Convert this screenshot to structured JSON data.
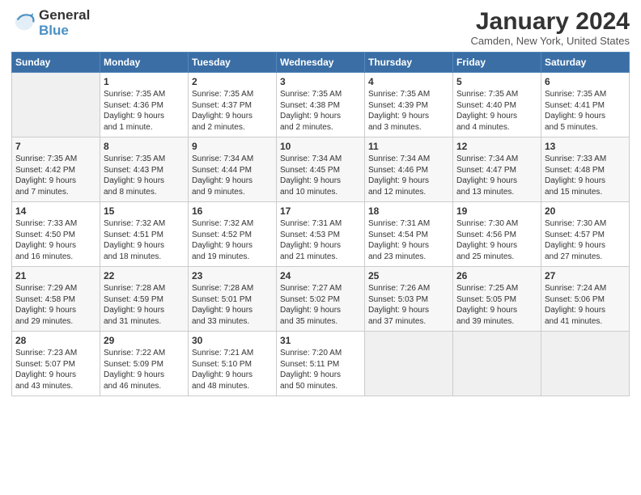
{
  "logo": {
    "text1": "General",
    "text2": "Blue"
  },
  "title": {
    "month_year": "January 2024",
    "location": "Camden, New York, United States"
  },
  "days_of_week": [
    "Sunday",
    "Monday",
    "Tuesday",
    "Wednesday",
    "Thursday",
    "Friday",
    "Saturday"
  ],
  "weeks": [
    [
      {
        "day": "",
        "info": ""
      },
      {
        "day": "1",
        "info": "Sunrise: 7:35 AM\nSunset: 4:36 PM\nDaylight: 9 hours\nand 1 minute."
      },
      {
        "day": "2",
        "info": "Sunrise: 7:35 AM\nSunset: 4:37 PM\nDaylight: 9 hours\nand 2 minutes."
      },
      {
        "day": "3",
        "info": "Sunrise: 7:35 AM\nSunset: 4:38 PM\nDaylight: 9 hours\nand 2 minutes."
      },
      {
        "day": "4",
        "info": "Sunrise: 7:35 AM\nSunset: 4:39 PM\nDaylight: 9 hours\nand 3 minutes."
      },
      {
        "day": "5",
        "info": "Sunrise: 7:35 AM\nSunset: 4:40 PM\nDaylight: 9 hours\nand 4 minutes."
      },
      {
        "day": "6",
        "info": "Sunrise: 7:35 AM\nSunset: 4:41 PM\nDaylight: 9 hours\nand 5 minutes."
      }
    ],
    [
      {
        "day": "7",
        "info": "Sunrise: 7:35 AM\nSunset: 4:42 PM\nDaylight: 9 hours\nand 7 minutes."
      },
      {
        "day": "8",
        "info": "Sunrise: 7:35 AM\nSunset: 4:43 PM\nDaylight: 9 hours\nand 8 minutes."
      },
      {
        "day": "9",
        "info": "Sunrise: 7:34 AM\nSunset: 4:44 PM\nDaylight: 9 hours\nand 9 minutes."
      },
      {
        "day": "10",
        "info": "Sunrise: 7:34 AM\nSunset: 4:45 PM\nDaylight: 9 hours\nand 10 minutes."
      },
      {
        "day": "11",
        "info": "Sunrise: 7:34 AM\nSunset: 4:46 PM\nDaylight: 9 hours\nand 12 minutes."
      },
      {
        "day": "12",
        "info": "Sunrise: 7:34 AM\nSunset: 4:47 PM\nDaylight: 9 hours\nand 13 minutes."
      },
      {
        "day": "13",
        "info": "Sunrise: 7:33 AM\nSunset: 4:48 PM\nDaylight: 9 hours\nand 15 minutes."
      }
    ],
    [
      {
        "day": "14",
        "info": "Sunrise: 7:33 AM\nSunset: 4:50 PM\nDaylight: 9 hours\nand 16 minutes."
      },
      {
        "day": "15",
        "info": "Sunrise: 7:32 AM\nSunset: 4:51 PM\nDaylight: 9 hours\nand 18 minutes."
      },
      {
        "day": "16",
        "info": "Sunrise: 7:32 AM\nSunset: 4:52 PM\nDaylight: 9 hours\nand 19 minutes."
      },
      {
        "day": "17",
        "info": "Sunrise: 7:31 AM\nSunset: 4:53 PM\nDaylight: 9 hours\nand 21 minutes."
      },
      {
        "day": "18",
        "info": "Sunrise: 7:31 AM\nSunset: 4:54 PM\nDaylight: 9 hours\nand 23 minutes."
      },
      {
        "day": "19",
        "info": "Sunrise: 7:30 AM\nSunset: 4:56 PM\nDaylight: 9 hours\nand 25 minutes."
      },
      {
        "day": "20",
        "info": "Sunrise: 7:30 AM\nSunset: 4:57 PM\nDaylight: 9 hours\nand 27 minutes."
      }
    ],
    [
      {
        "day": "21",
        "info": "Sunrise: 7:29 AM\nSunset: 4:58 PM\nDaylight: 9 hours\nand 29 minutes."
      },
      {
        "day": "22",
        "info": "Sunrise: 7:28 AM\nSunset: 4:59 PM\nDaylight: 9 hours\nand 31 minutes."
      },
      {
        "day": "23",
        "info": "Sunrise: 7:28 AM\nSunset: 5:01 PM\nDaylight: 9 hours\nand 33 minutes."
      },
      {
        "day": "24",
        "info": "Sunrise: 7:27 AM\nSunset: 5:02 PM\nDaylight: 9 hours\nand 35 minutes."
      },
      {
        "day": "25",
        "info": "Sunrise: 7:26 AM\nSunset: 5:03 PM\nDaylight: 9 hours\nand 37 minutes."
      },
      {
        "day": "26",
        "info": "Sunrise: 7:25 AM\nSunset: 5:05 PM\nDaylight: 9 hours\nand 39 minutes."
      },
      {
        "day": "27",
        "info": "Sunrise: 7:24 AM\nSunset: 5:06 PM\nDaylight: 9 hours\nand 41 minutes."
      }
    ],
    [
      {
        "day": "28",
        "info": "Sunrise: 7:23 AM\nSunset: 5:07 PM\nDaylight: 9 hours\nand 43 minutes."
      },
      {
        "day": "29",
        "info": "Sunrise: 7:22 AM\nSunset: 5:09 PM\nDaylight: 9 hours\nand 46 minutes."
      },
      {
        "day": "30",
        "info": "Sunrise: 7:21 AM\nSunset: 5:10 PM\nDaylight: 9 hours\nand 48 minutes."
      },
      {
        "day": "31",
        "info": "Sunrise: 7:20 AM\nSunset: 5:11 PM\nDaylight: 9 hours\nand 50 minutes."
      },
      {
        "day": "",
        "info": ""
      },
      {
        "day": "",
        "info": ""
      },
      {
        "day": "",
        "info": ""
      }
    ]
  ]
}
